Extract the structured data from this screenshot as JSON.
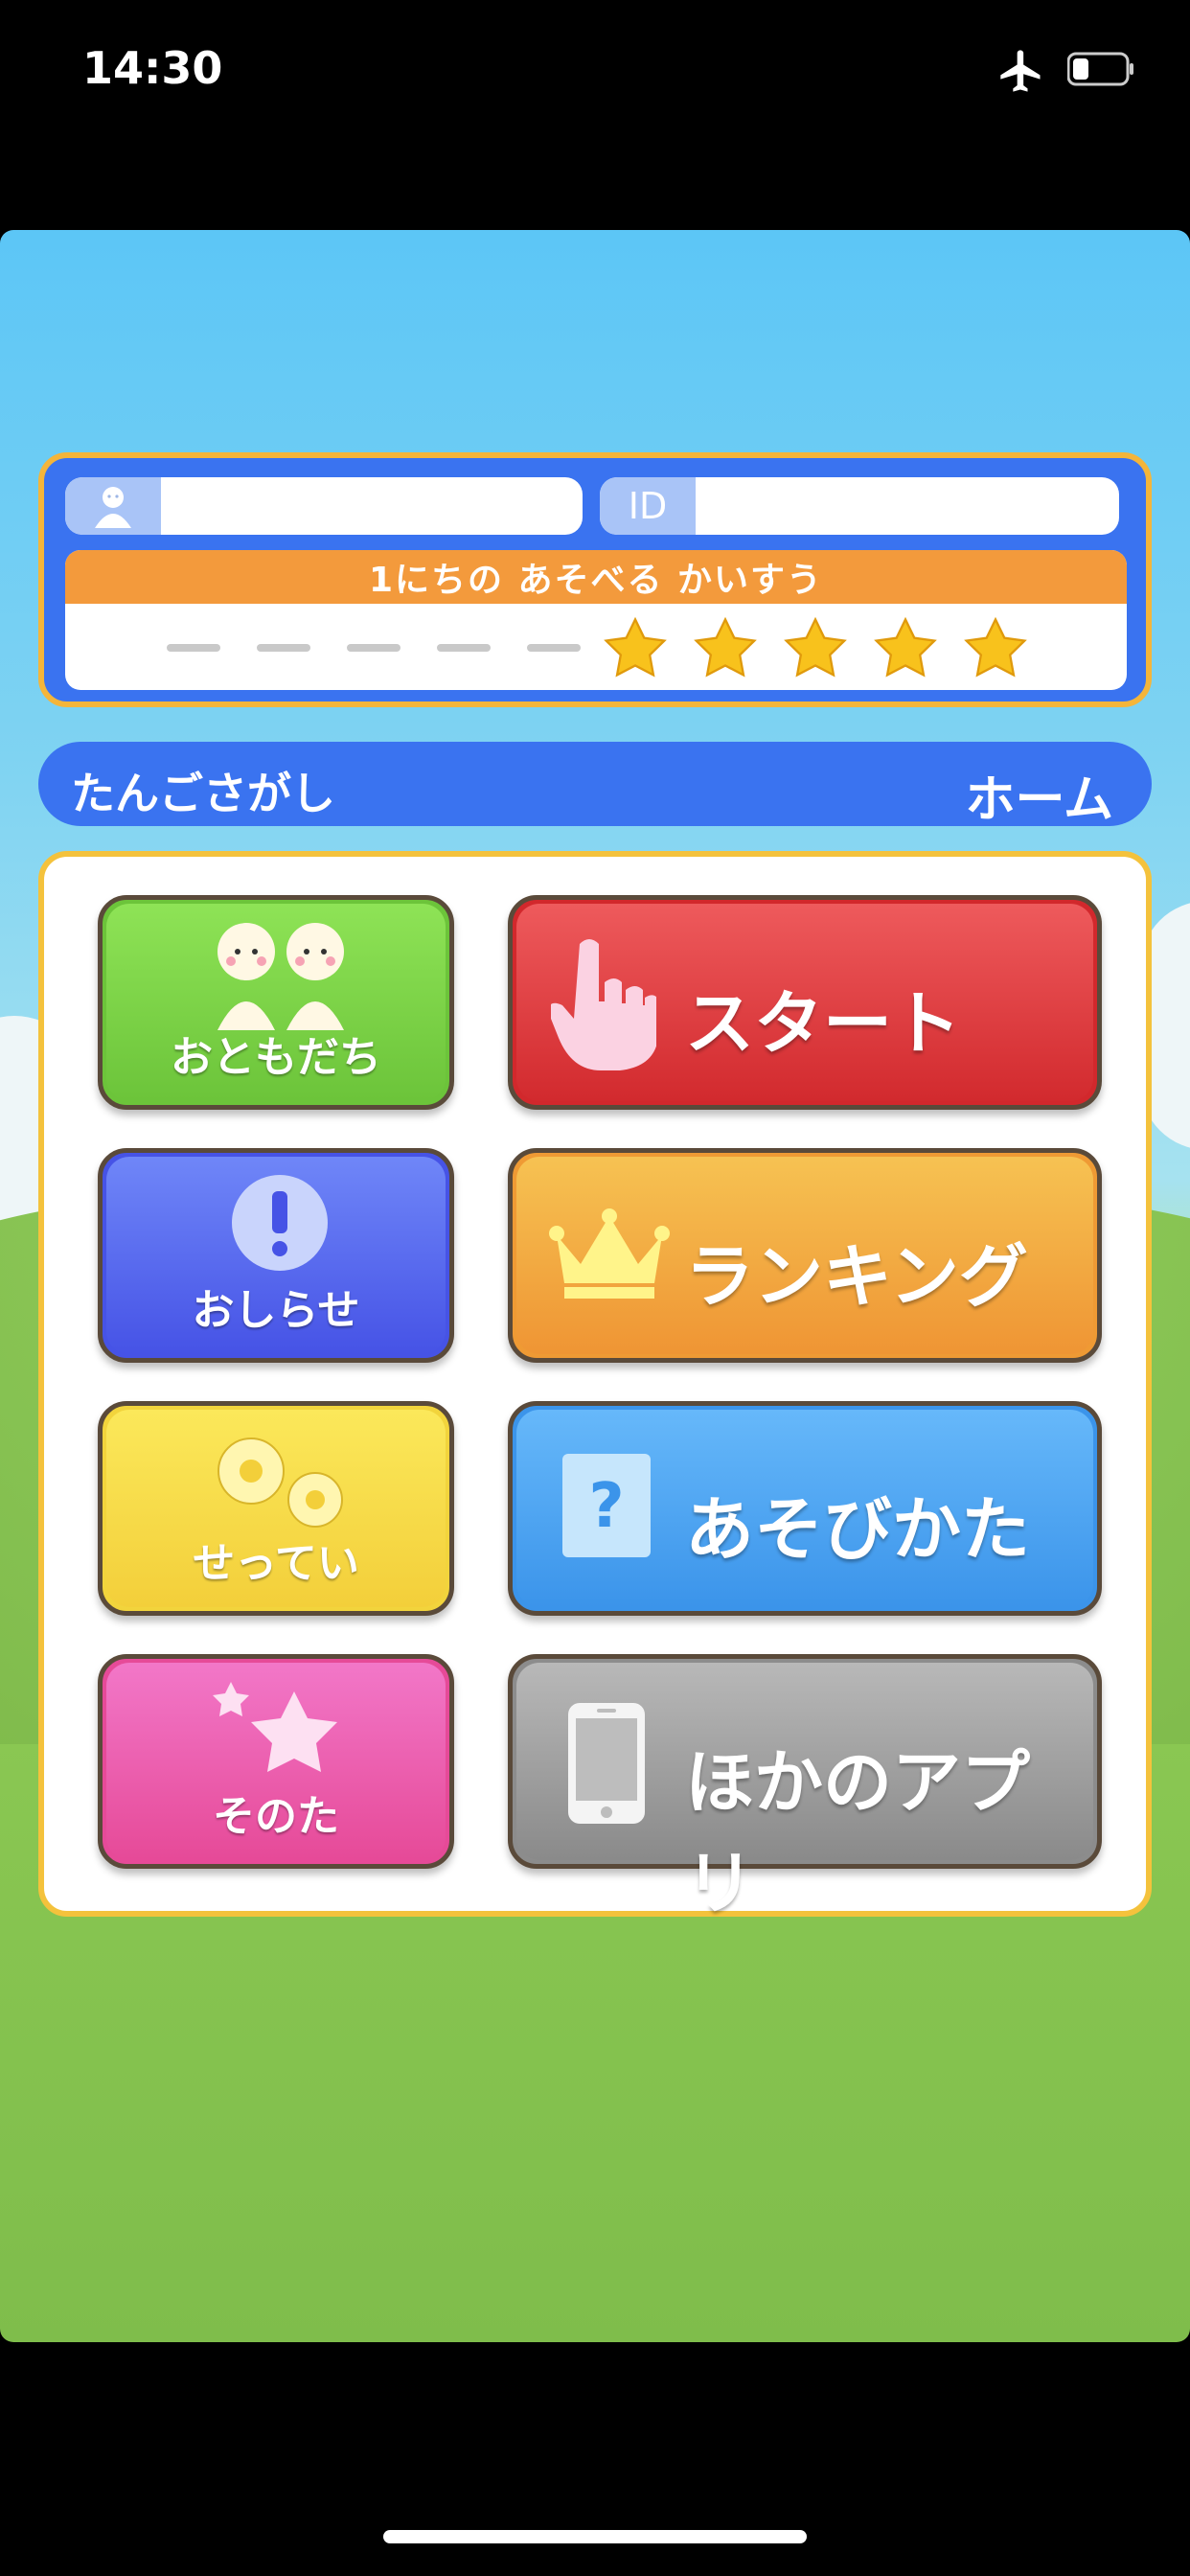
{
  "status_bar": {
    "time": "14:30",
    "battery_level": 0.25
  },
  "profile": {
    "user_name": "",
    "id_label": "ID",
    "id_value": "",
    "plays_per_day_label": "1にちの あそべる かいすう",
    "plays_used": 0,
    "plays_total": 5
  },
  "title_bar": {
    "game_name": "たんごさがし",
    "page": "ホーム"
  },
  "menu": {
    "friends": "おともだち",
    "start": "スタート",
    "news": "おしらせ",
    "ranking": "ランキング",
    "settings": "せってい",
    "how_to_play": "あそびかた",
    "other": "そのた",
    "other_apps": "ほかのアプリ"
  },
  "colors": {
    "friends": "#7ed143",
    "start": "#e03a3c",
    "news": "#5563f0",
    "ranking": "#f2a640",
    "settings": "#f6d84a",
    "how_to_play": "#4aa4f2",
    "other": "#ec5aa6",
    "other_apps": "#9a9a9a"
  }
}
